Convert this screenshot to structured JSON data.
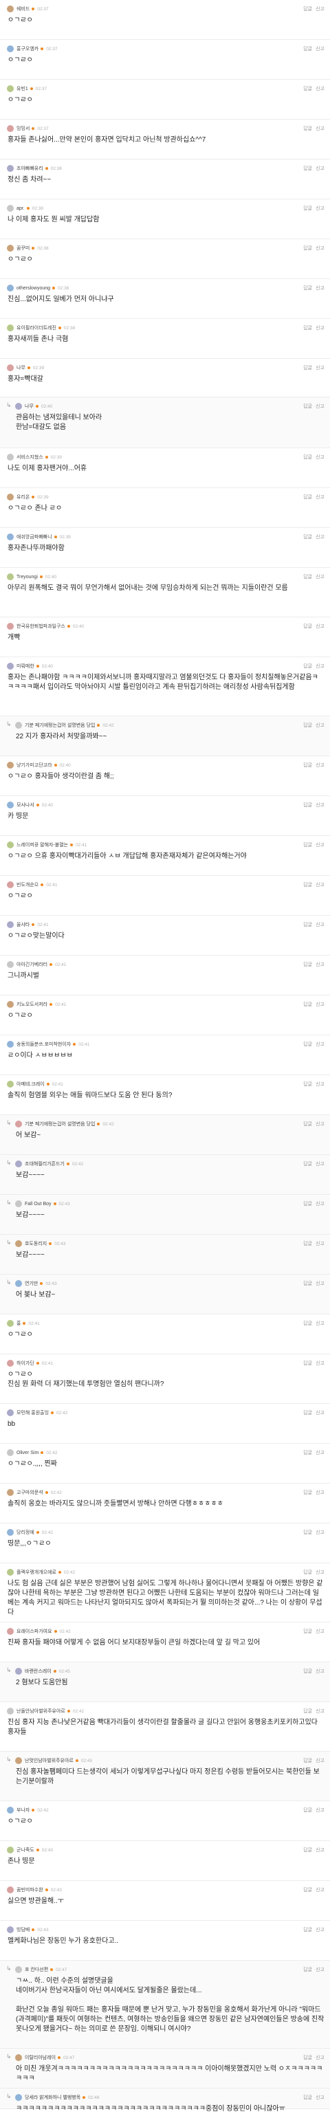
{
  "actions": {
    "reply": "답글",
    "report": "신고"
  },
  "colors": {
    "accent": "#f08a24",
    "avatar": [
      "#c9a27a",
      "#8fb3d9",
      "#b6c98a",
      "#d9a0a0",
      "#a9a9c9",
      "#c7c7c7"
    ]
  },
  "comments": [
    {
      "nick": "쉐비드",
      "time": "02:37",
      "text": "ㅇㄱㄹㅇ",
      "reply": false,
      "ch": 58
    },
    {
      "nick": "홍구오엠카",
      "time": "02:37",
      "text": "ㅇㄱㄹㅇ",
      "reply": false,
      "ch": 58
    },
    {
      "nick": "유빈1",
      "time": "02:37",
      "text": "ㅇㄱㄹㅇ",
      "reply": false,
      "ch": 58
    },
    {
      "nick": "밍밍서",
      "time": "02:37",
      "text": "홍자들 존나싫어...만약 본인이 홍자면 입닥치고 아닌척 방관하십쇼^^7",
      "reply": false,
      "ch": 58
    },
    {
      "nick": "조아빠빠유리",
      "time": "02:38",
      "text": "정신 좀 차려~~",
      "reply": false,
      "ch": 58
    },
    {
      "nick": "apr.",
      "time": "02:38",
      "text": "나 이제 홍자도 뭔 씨발 개답답함",
      "reply": false,
      "ch": 58
    },
    {
      "nick": "꿈꾸미",
      "time": "02:38",
      "text": "ㅇㄱㄹㅇ",
      "reply": false,
      "ch": 58
    },
    {
      "nick": "otherslowyoung",
      "time": "02:38",
      "text": "진심...없어지도 일베가 먼저 아니냐구",
      "reply": false,
      "ch": 58
    },
    {
      "nick": "유이필라이더트레진",
      "time": "02:38",
      "text": "홍자새끼들 존나 극혐",
      "reply": false,
      "ch": 58
    },
    {
      "nick": "나무",
      "time": "02:39",
      "text": "홍자=빡대갈",
      "reply": false,
      "ch": 56
    },
    {
      "nick": "나무",
      "time": "02:40",
      "text": "관음하는 냄져있을테니 보아라\n한남=대갈도 없음",
      "reply": true,
      "ch": 74
    },
    {
      "nick": "서비스지쳤스",
      "time": "02:39",
      "text": "나도 이제 홍자팬거야...어휴",
      "reply": false,
      "ch": 58
    },
    {
      "nick": "유리온",
      "time": "02:39",
      "text": "ㅇㄱㄹㅇ 존나 ㄹㅇ",
      "reply": false,
      "ch": 58
    },
    {
      "nick": "애쉬앙금파빠빠니",
      "time": "02:39",
      "text": "홍자존나뚜까패야함",
      "reply": false,
      "ch": 58
    },
    {
      "nick": "Treyoungi",
      "time": "02:40",
      "text": "아무리 원폭해도 결국 뭐이 무언가해서 없어내는 것에 무임승차하게 되는건 뭐까는 지들이란건 모름",
      "reply": false,
      "ch": 72
    },
    {
      "nick": "한국유한퇴법파과일구스",
      "time": "02:40",
      "text": "개빡",
      "reply": false,
      "ch": 58
    },
    {
      "nick": "미뤄매한",
      "time": "02:40",
      "text": "홍자는 존나패야함 ㅋㅋㅋㅋ이제와서보니까 홍자때지말라고 염불외던것도 다 홍자들이 정치질해놓은거같음ㅋㅋㅋㅋㅋ패서 입이라도 막아놔야지 시발 틀린엄이라고 계속 판뒤집기하려는 애리청성 사람속뒤집게함",
      "reply": false,
      "ch": 86
    },
    {
      "nick": "기분 페기에펑는겁어 설명변음 당입",
      "time": "02:42",
      "text": "22 지가 홍자라서 처맞을까봐~~",
      "reply": true,
      "ch": 58
    },
    {
      "nick": "냥기가미고단고라",
      "time": "02:40",
      "text": "ㅇㄱㄹㅇ 홍자들아 생각이란걸 좀 해;;",
      "reply": false,
      "ch": 58
    },
    {
      "nick": "모사나서",
      "time": "02:40",
      "text": "카 띵문",
      "reply": false,
      "ch": 58
    },
    {
      "nick": "느레이퍼뀻 말해자-불렬는",
      "time": "02:41",
      "text": "ㅇㄱㄹㅇ 으휴 홍자이빡대가리들아 ㅅㅂ 개답답해 홍자존재자체가 같은여자해는거야",
      "reply": false,
      "ch": 58
    },
    {
      "nick": "빈도개순으",
      "time": "02:41",
      "text": "ㅇㄱㄹㅇ",
      "reply": false,
      "ch": 58
    },
    {
      "nick": "울샤타",
      "time": "02:41",
      "text": "ㅇㄱㄹㅇ맞는말이다",
      "reply": false,
      "ch": 58
    },
    {
      "nick": "아아긴기베라터",
      "time": "02:41",
      "text": "그니까시벌",
      "reply": false,
      "ch": 58
    },
    {
      "nick": "키노오도서저라",
      "time": "02:41",
      "text": "ㅇㄱㄹㅇ",
      "reply": false,
      "ch": 58
    },
    {
      "nick": "숭동의들분쓰.포미착현이자",
      "time": "02:41",
      "text": "ㄹㅇ이다 ㅅㅂㅂㅂㅂㅂ",
      "reply": false,
      "ch": 58
    },
    {
      "nick": "아메테.크레이",
      "time": "02:41",
      "text": "솔직히 험염블 외우는 애들 워마드보다 도움 안 된다 동의?",
      "reply": false,
      "ch": 58
    },
    {
      "nick": "기분 페기에펑는겁어 설명변음 당입",
      "time": "02:42",
      "text": "어 보감~",
      "reply": true,
      "ch": 58
    },
    {
      "nick": "조대해필리가흔드기",
      "time": "02:42",
      "text": "보감~~~~",
      "reply": true,
      "ch": 58
    },
    {
      "nick": "Fall Out Boy",
      "time": "02:43",
      "text": "보감~~~~",
      "reply": true,
      "ch": 58
    },
    {
      "nick": "호도동리지",
      "time": "02:43",
      "text": "보감~~~~",
      "reply": true,
      "ch": 58
    },
    {
      "nick": "연기만",
      "time": "02:43",
      "text": "어 봊나 보감~",
      "reply": true,
      "ch": 58
    },
    {
      "nick": "홍",
      "time": "02:41",
      "text": "ㅇㄱㄹㅇ",
      "reply": false,
      "ch": 58
    },
    {
      "nick": "하이가딘",
      "time": "02:41",
      "text": "ㅇㄱㄹㅇ\n진심 뭔 화력 더 재기했는데 투명험만 열심히 팬다니까?",
      "reply": false,
      "ch": 72
    },
    {
      "nick": "모민해 홍원출잉",
      "time": "02:42",
      "text": "bb",
      "reply": false,
      "ch": 58
    },
    {
      "nick": "Oliver Sim",
      "time": "02:42",
      "text": "ㅇㄱㄹㅇ.,,,, 찐짜",
      "reply": false,
      "ch": 58
    },
    {
      "nick": "고구마의문석",
      "time": "02:42",
      "text": "솔직히 옹호는 바라지도 않으니까 줏들빨면서 방해나 안하면 다행ㅎㅎㅎㅎㅎ",
      "reply": false,
      "ch": 58
    },
    {
      "nick": "당리정에",
      "time": "02:42",
      "text": "띵문,,,ㅇㄱㄹㅇ",
      "reply": false,
      "ch": 58
    },
    {
      "nick": "플랙우랭개개으에로",
      "time": "02:42",
      "text": "나도 험 싫음 근데 싫은 부분은 방관했어 남험 싫어도 그렇게 하나하나 물어다니면서 뭇패질 아 어쨌든 방향은 같잖아 나한테 욕하는 부분은 그냥 방관하면 된다고 어쨌든 나한테 도움되는 부분이 컸잖아 워마드나 그러는데 일베는 계속 커지고 워마드는 나타난지 얼마되지도 않아서 폭파되는거 뭘 의미하는것 같아...? 나는 이 상황이 무섭다",
      "reply": false,
      "ch": 86
    },
    {
      "nick": "요래이스파가여요",
      "time": "02:42",
      "text": "진짜 홍자들 패야돼 어떻게 수 없음 어디 보지대장부들이 큰일 하겠다는데 앞 길 막고 있어",
      "reply": false,
      "ch": 58
    },
    {
      "nick": "바랜란스레이",
      "time": "02:45",
      "text": "2 혐보다 도움안됨",
      "reply": true,
      "ch": 58
    },
    {
      "nick": "난둘안남아벌위주유아르",
      "time": "02:42",
      "text": "진심 홍자 지능 존나낮은거같음 빡대가리들이 생각이란걸 할줄몰라 글 길다고 안읽어 옹행웅초키포키하고있다 홍자들",
      "reply": false,
      "ch": 72
    },
    {
      "nick": "난멋인남아벌위주유아르",
      "time": "02:45",
      "text": "진심 홍자놀팸페미다 드는생각이 세뇌가 이렇게무섭구나싶다 마지 정은킴 수령등 받들어모시는 북한인들 보는기분이랄까",
      "reply": true,
      "ch": 72
    },
    {
      "nick": "부나자",
      "time": "02:42",
      "text": "ㅇㄱㄹㅇ",
      "reply": false,
      "ch": 58
    },
    {
      "nick": "군나죽도",
      "time": "02:43",
      "text": "존나 띵문",
      "reply": false,
      "ch": 58
    },
    {
      "nick": "꿈빈미파수완",
      "time": "02:43",
      "text": "싫으면 방관을해..ㅜ",
      "reply": false,
      "ch": 58
    },
    {
      "nick": "빙담배",
      "time": "02:43",
      "text": "멜케화나님은 장동민 누가 옹호한다고..",
      "reply": false,
      "ch": 58
    },
    {
      "nick": "포 칸다선편",
      "time": "02:47",
      "text": "ㄱㅆ.. 하.. 이런 수준의 설명댓글을\n네이버기사 한남국자들이 아닌 여시에서도 달게될줄은 몰랐는데...\n\n화난건 오늘 종일 워마드 패는 홍자들 때문에 뿐 난거 맞고, 누가 장동민을 옹호해서 화가난게 아니라 \"워마드(과격페미)\"를 패듯이 여형하는 컨텐츠, 여형하는 방송인들을 왜으면 장동민 같은 남자연예인들은 방송에 진작 못나오게 됐을거다~ 하는 의미로 쓴 문장임. 이해되니 여시야?",
      "reply": true,
      "ch": 128
    },
    {
      "nick": "이탈리아남레이",
      "time": "02:47",
      "text": "아 미친 개웃겨ㅋㅋㅋㅋㅋㅋㅋㅋㅋㅋㅋㅋㅋㅋㅋㅋㅋㅋㅋㅋㅋㅋㅋ 이아이해못했겠지만 노력 ㅇㅈㅋㅋㅋㅋㅋㅋㅋㅋ",
      "reply": true,
      "ch": 58
    },
    {
      "nick": "당세라 밝계화하니 벨벵병목",
      "time": "02:48",
      "text": "ㅋㅋㅋㅋㅋㅋㅋㅋㅋㅋㅋㅋㅋㅋㅋㅋㅋㅋㅋㅋㅋㅋㅋㅋㅋㅋㅋㅋㅋㅋ중점이 장동민이 아니잖아ㅠ",
      "reply": true,
      "ch": 30
    }
  ]
}
